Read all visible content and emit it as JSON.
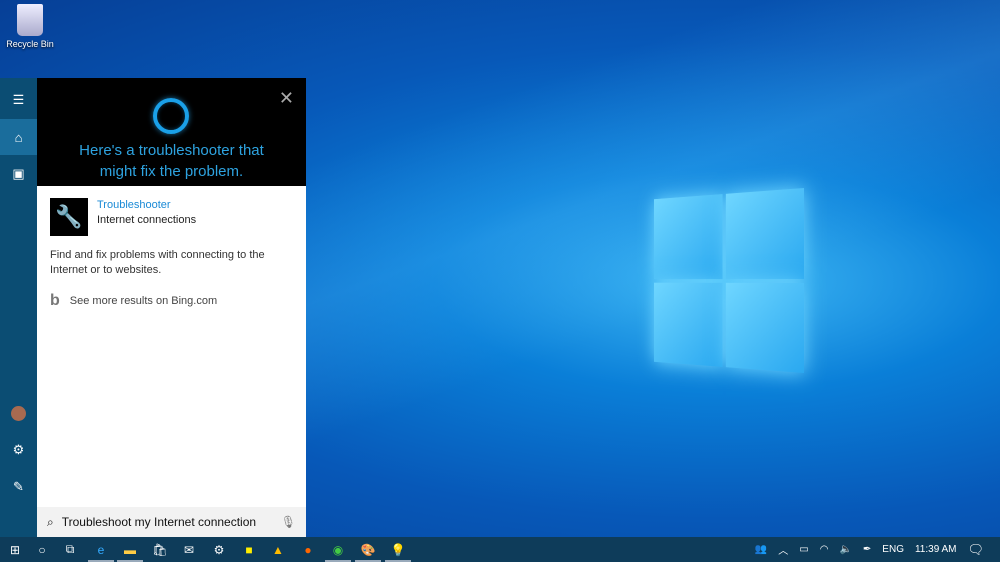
{
  "desktop": {
    "recycle_bin": "Recycle Bin"
  },
  "cortana": {
    "headline_1": "Here's a troubleshooter that",
    "headline_2": "might fix the problem.",
    "result_title": "Troubleshooter",
    "result_subtitle": "Internet connections",
    "description": "Find and fix problems with connecting to the Internet or to websites.",
    "bing_link": "See more results on Bing.com",
    "search_value": "Troubleshoot my Internet connection",
    "accent": "#2ea3e0"
  },
  "taskbar": {
    "language": "ENG",
    "time": "11:39 AM",
    "apps": [
      "start",
      "cortana",
      "task-view",
      "edge",
      "file-explorer",
      "store",
      "mail",
      "settings",
      "sticky-notes",
      "google-ads",
      "firefox",
      "chrome",
      "paint-3d",
      "tips"
    ]
  }
}
